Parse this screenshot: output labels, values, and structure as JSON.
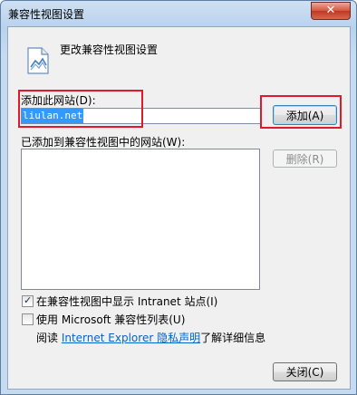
{
  "window": {
    "title": "兼容性视图设置",
    "close_glyph": "✕"
  },
  "header": {
    "text": "更改兼容性视图设置",
    "icon": "document-image-icon"
  },
  "add_site": {
    "label": "添加此网站(D):",
    "value": "liulan.net",
    "button_label": "添加(A)"
  },
  "sites_list": {
    "label": "已添加到兼容性视图中的网站(W):",
    "items": [],
    "remove_button_label": "删除(R)"
  },
  "options": {
    "intranet_label": "在兼容性视图中显示 Intranet 站点(I)",
    "intranet_checked": true,
    "microsoft_label": "使用 Microsoft 兼容性列表(U)",
    "microsoft_checked": false
  },
  "footer": {
    "read_prefix": "阅读 ",
    "privacy_link": "Internet Explorer 隐私声明",
    "read_suffix": "了解详细信息",
    "close_button_label": "关闭(C)"
  },
  "highlights": {
    "color": "#e0192f"
  },
  "colors": {
    "selection": "#3399ff",
    "link": "#0066cc"
  }
}
